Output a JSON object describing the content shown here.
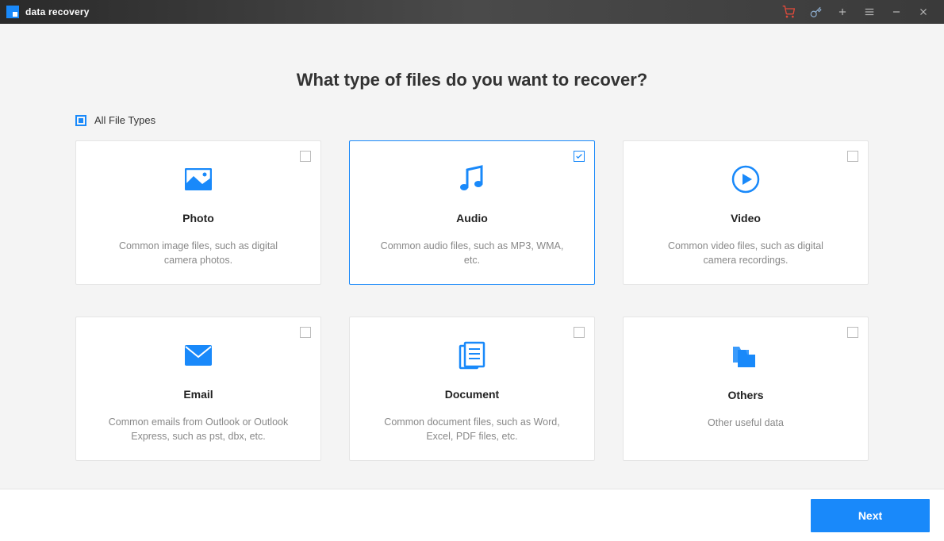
{
  "app_title": "data recovery",
  "heading": "What type of files do you want to recover?",
  "all_types_label": "All File Types",
  "all_types_checked": true,
  "cards": [
    {
      "title": "Photo",
      "desc": "Common image files, such as digital camera photos.",
      "selected": false
    },
    {
      "title": "Audio",
      "desc": "Common audio files, such as MP3, WMA, etc.",
      "selected": true
    },
    {
      "title": "Video",
      "desc": "Common video files, such as digital camera recordings.",
      "selected": false
    },
    {
      "title": "Email",
      "desc": "Common emails from Outlook or Outlook Express, such as pst, dbx, etc.",
      "selected": false
    },
    {
      "title": "Document",
      "desc": "Common document files, such as Word, Excel, PDF files, etc.",
      "selected": false
    },
    {
      "title": "Others",
      "desc": "Other useful data",
      "selected": false
    }
  ],
  "next_button": "Next",
  "colors": {
    "accent": "#1989fa"
  }
}
